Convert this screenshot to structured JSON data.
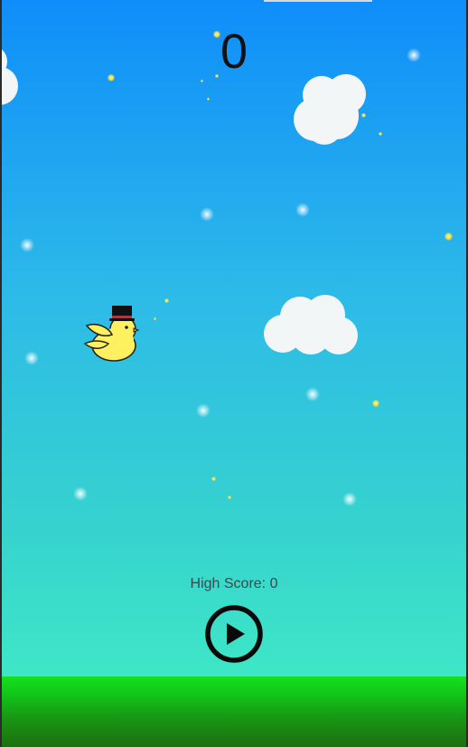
{
  "game": {
    "score": "0",
    "high_score_text": "High Score: 0",
    "play_icon": "play-icon",
    "player_icon": "bird-with-top-hat-icon"
  },
  "colors": {
    "sky_top": "#0f8dfa",
    "sky_bottom": "#3ee6c6",
    "ground": "#16e01e",
    "bird": "#ffef5e",
    "hat_band": "#e0202a"
  }
}
